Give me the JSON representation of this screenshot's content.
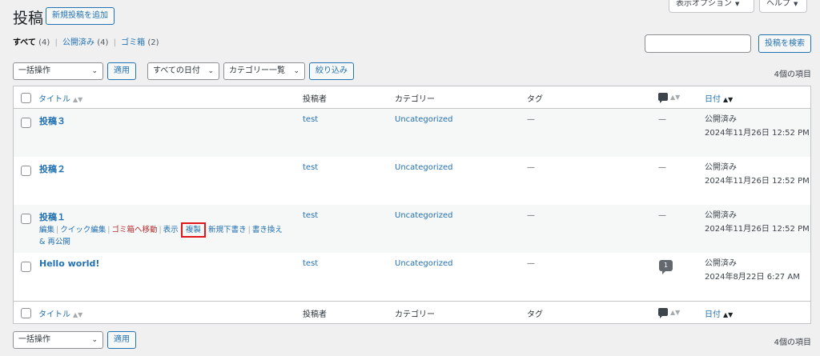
{
  "header": {
    "title": "投稿",
    "add_new": "新規投稿を追加",
    "screen_options": "表示オプション",
    "help": "ヘルプ"
  },
  "views": {
    "all_label": "すべて",
    "all_count": "(4)",
    "published_label": "公開済み",
    "published_count": "(4)",
    "trash_label": "ゴミ箱",
    "trash_count": "(2)",
    "sep": "|"
  },
  "search": {
    "button": "投稿を検索",
    "value": ""
  },
  "filters": {
    "bulk_actions": "一括操作",
    "apply": "適用",
    "dates": "すべての日付",
    "category": "カテゴリー一覧",
    "filter": "絞り込み"
  },
  "items_count": "4個の項目",
  "columns": {
    "title": "タイトル",
    "author": "投稿者",
    "categories": "カテゴリー",
    "tags": "タグ",
    "date": "日付"
  },
  "posts": [
    {
      "title": "投稿３",
      "author": "test",
      "category": "Uncategorized",
      "tags": "—",
      "comments": "—",
      "status": "公開済み",
      "date": "2024年11月26日 12:52 PM"
    },
    {
      "title": "投稿２",
      "author": "test",
      "category": "Uncategorized",
      "tags": "—",
      "comments": "—",
      "status": "公開済み",
      "date": "2024年11月26日 12:52 PM"
    },
    {
      "title": "投稿１",
      "author": "test",
      "category": "Uncategorized",
      "tags": "—",
      "comments": "—",
      "status": "公開済み",
      "date": "2024年11月26日 12:52 PM"
    },
    {
      "title": "Hello world!",
      "author": "test",
      "category": "Uncategorized",
      "tags": "—",
      "comments": "1",
      "status": "公開済み",
      "date": "2024年8月22日 6:27 AM"
    }
  ],
  "row_actions": {
    "edit": "編集",
    "quick_edit": "クイック編集",
    "trash": "ゴミ箱へ移動",
    "view": "表示",
    "duplicate": "複製",
    "new_draft": "新規下書き",
    "rewrite": "書き換え & 再公開",
    "sep": "|"
  },
  "colors": {
    "accent": "#2271b1",
    "danger": "#b32d2e",
    "highlight": "#e0161b"
  }
}
